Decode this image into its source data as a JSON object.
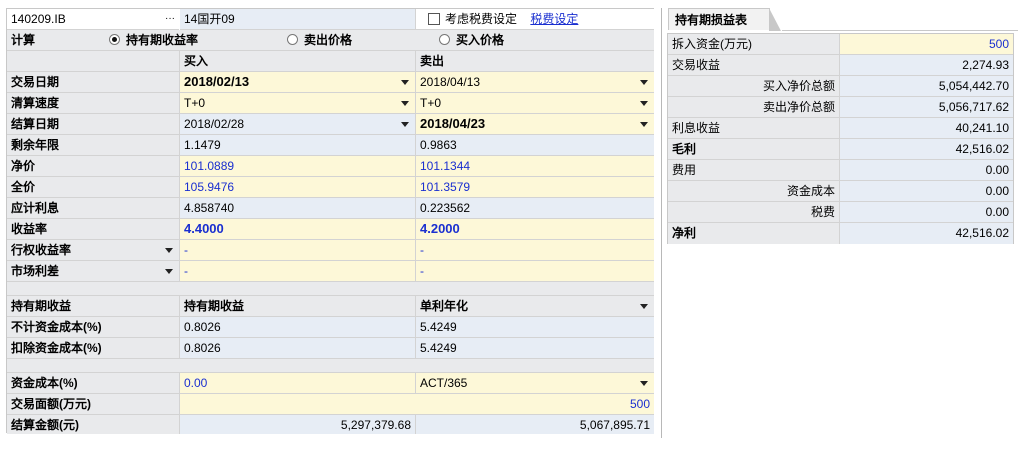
{
  "top": {
    "bond_code": "140209.IB",
    "ellipsis": "···",
    "bond_name": "14国开09",
    "tax_checkbox_label": "考虑税费设定",
    "tax_link": "税费设定"
  },
  "calc": {
    "label": "计算",
    "options": [
      "持有期收益率",
      "卖出价格",
      "买入价格"
    ],
    "selected": "持有期收益率"
  },
  "columns": {
    "buy": "买入",
    "sell": "卖出"
  },
  "rows": {
    "trade_date": {
      "label": "交易日期",
      "buy": "2018/02/13",
      "sell": "2018/04/13"
    },
    "settle_speed": {
      "label": "清算速度",
      "buy": "T+0",
      "sell": "T+0"
    },
    "settle_date": {
      "label": "结算日期",
      "buy": "2018/02/28",
      "sell": "2018/04/23"
    },
    "remaining_years": {
      "label": "剩余年限",
      "buy": "1.1479",
      "sell": "0.9863"
    },
    "clean_price": {
      "label": "净价",
      "buy": "101.0889",
      "sell": "101.1344"
    },
    "full_price": {
      "label": "全价",
      "buy": "105.9476",
      "sell": "101.3579"
    },
    "accrued_interest": {
      "label": "应计利息",
      "buy": "4.858740",
      "sell": "0.223562"
    },
    "yield": {
      "label": "收益率",
      "buy": "4.4000",
      "sell": "4.2000"
    },
    "exercise_yield": {
      "label": "行权收益率",
      "buy": "-",
      "sell": "-"
    },
    "market_spread": {
      "label": "市场利差",
      "buy": "-",
      "sell": "-"
    }
  },
  "holding": {
    "label": "持有期收益",
    "col1": "持有期收益",
    "col2": "单利年化",
    "rows": [
      {
        "label": "不计资金成本(%)",
        "v1": "0.8026",
        "v2": "5.4249"
      },
      {
        "label": "扣除资金成本(%)",
        "v1": "0.8026",
        "v2": "5.4249"
      }
    ]
  },
  "funding": {
    "cost_label": "资金成本(%)",
    "cost_value": "0.00",
    "day_count": "ACT/365",
    "face_label": "交易面额(万元)",
    "face_value": "500",
    "settle_amount_label": "结算金额(元)",
    "settle_buy": "5,297,379.68",
    "settle_sell": "5,067,895.71"
  },
  "pnl": {
    "tab_title": "持有期损益表",
    "rows": [
      {
        "label": "拆入资金(万元)",
        "value": "500"
      },
      {
        "label": "交易收益",
        "value": "2,274.93"
      },
      {
        "label": "买入净价总额",
        "value": "5,054,442.70"
      },
      {
        "label": "卖出净价总额",
        "value": "5,056,717.62"
      },
      {
        "label": "利息收益",
        "value": "40,241.10"
      },
      {
        "label": "毛利",
        "value": "42,516.02"
      },
      {
        "label": "费用",
        "value": "0.00"
      },
      {
        "label": "资金成本",
        "value": "0.00"
      },
      {
        "label": "税费",
        "value": "0.00"
      },
      {
        "label": "净利",
        "value": "42,516.02"
      }
    ]
  }
}
